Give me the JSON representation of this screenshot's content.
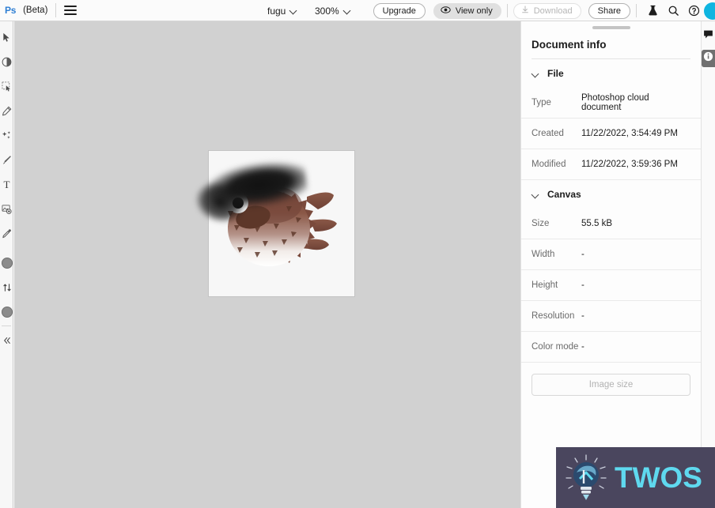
{
  "app": {
    "logo": "Ps",
    "beta_label": "(Beta)",
    "menu_icon": "hamburger-menu-icon"
  },
  "topbar": {
    "document_name": "fugu",
    "zoom_level": "300%",
    "upgrade_label": "Upgrade",
    "view_only_label": "View only",
    "download_label": "Download",
    "share_label": "Share",
    "icons": {
      "beaker": "beaker-icon",
      "search": "search-icon",
      "help": "help-circle-icon",
      "avatar": "user-avatar",
      "eye": "eye-icon",
      "download": "download-arrow-icon",
      "chevron": "chevron-down-icon"
    },
    "colors": {
      "logo_blue": "#2f7fd4",
      "avatar_cyan": "#0fb5e0",
      "view_only_bg": "#e0e0e0"
    }
  },
  "left_toolbar": {
    "tools": [
      {
        "name": "move-tool",
        "icon": "cursor-arrow-icon"
      },
      {
        "name": "quick-mask-tool",
        "icon": "half-circle-icon"
      },
      {
        "name": "object-select-tool",
        "icon": "marquee-select-icon"
      },
      {
        "name": "healing-brush-tool",
        "icon": "healing-brush-icon"
      },
      {
        "name": "spot-heal-tool",
        "icon": "sparkles-icon"
      },
      {
        "name": "brush-tool",
        "icon": "paintbrush-icon"
      },
      {
        "name": "type-tool",
        "icon": "text-t-icon"
      },
      {
        "name": "place-image-tool",
        "icon": "place-image-icon"
      },
      {
        "name": "eyedropper-tool",
        "icon": "eyedropper-icon"
      }
    ],
    "foreground_color": "#8c8c8c",
    "background_color": "#8c8c8c",
    "swap_icon": "swap-arrows-icon",
    "collapse_icon": "double-chevron-left-icon"
  },
  "canvas": {
    "background_color": "#d1d1d1",
    "artboard_background": "#f7f7f7",
    "artwork": "blowfish-emoji-with-black-brush-stroke"
  },
  "panel": {
    "title": "Document info",
    "sections": [
      {
        "name": "file",
        "label": "File",
        "expanded": true,
        "rows": [
          {
            "key": "Type",
            "value": "Photoshop cloud document"
          },
          {
            "key": "Created",
            "value": "11/22/2022, 3:54:49 PM"
          },
          {
            "key": "Modified",
            "value": "11/22/2022, 3:59:36 PM"
          }
        ]
      },
      {
        "name": "canvas",
        "label": "Canvas",
        "expanded": true,
        "rows": [
          {
            "key": "Size",
            "value": "55.5 kB"
          },
          {
            "key": "Width",
            "value": "-"
          },
          {
            "key": "Height",
            "value": "-"
          },
          {
            "key": "Resolution",
            "value": "-"
          },
          {
            "key": "Color mode",
            "value": "-"
          }
        ]
      }
    ],
    "image_size_button": "Image size"
  },
  "right_rail": {
    "buttons": [
      {
        "name": "comments-panel-button",
        "icon": "comment-bubble-icon",
        "active": false
      },
      {
        "name": "document-info-panel-button",
        "icon": "info-circle-icon",
        "active": true
      }
    ]
  },
  "watermark": {
    "text": "TWOS",
    "icon": "lightbulb-icon",
    "background_color": "#4a465e",
    "text_color": "#5fd9ef"
  }
}
